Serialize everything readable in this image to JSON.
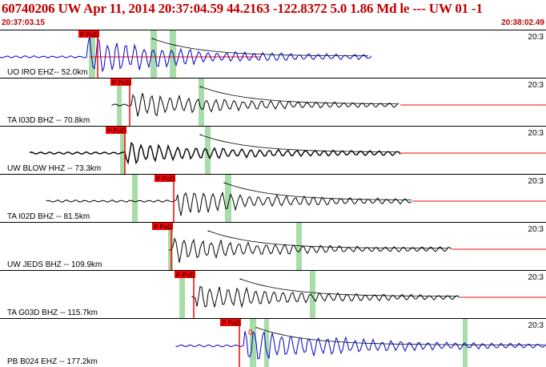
{
  "header": {
    "title": "60740206 UW Apr 11, 2014 20:37:04.59    44.2163 -122.8372  5.0 1.86 Md le --- UW 01   -1",
    "start_time": "20:37:03.15",
    "end_time": "20:38:02.49"
  },
  "colors": {
    "title": "#c00000",
    "pick": "#ff0000",
    "window": "#a8dca8",
    "trace_blue": "#0000cc",
    "trace_black": "#000000"
  },
  "panels": [
    {
      "label": "UO IRO EHZ-- 52.0km",
      "scale": "20:3",
      "pick": "P PoD",
      "trace_color": "#0000cc"
    },
    {
      "label": "TA I03D BHZ -- 70.8km",
      "scale": "20:3",
      "pick": "P PoD",
      "trace_color": "#000000"
    },
    {
      "label": "UW BLOW HHZ -- 73.3km",
      "scale": "20:3",
      "pick": "P PoD",
      "trace_color": "#000000"
    },
    {
      "label": "TA I02D BHZ -- 81.5km",
      "scale": "20:3",
      "pick": "P PoD",
      "trace_color": "#000000"
    },
    {
      "label": "UW JEDS BHZ -- 109.9km",
      "scale": "20:3",
      "pick": "P PoD",
      "trace_color": "#000000"
    },
    {
      "label": "TA G03D BHZ -- 115.7km",
      "scale": "20:3",
      "pick": "P PoD",
      "trace_color": "#000000"
    },
    {
      "label": "PB B024 EHZ -- 177.2km",
      "scale": "20:3",
      "pick": "P PoD",
      "trace_color": "#0000cc",
      "marker": "0"
    }
  ]
}
